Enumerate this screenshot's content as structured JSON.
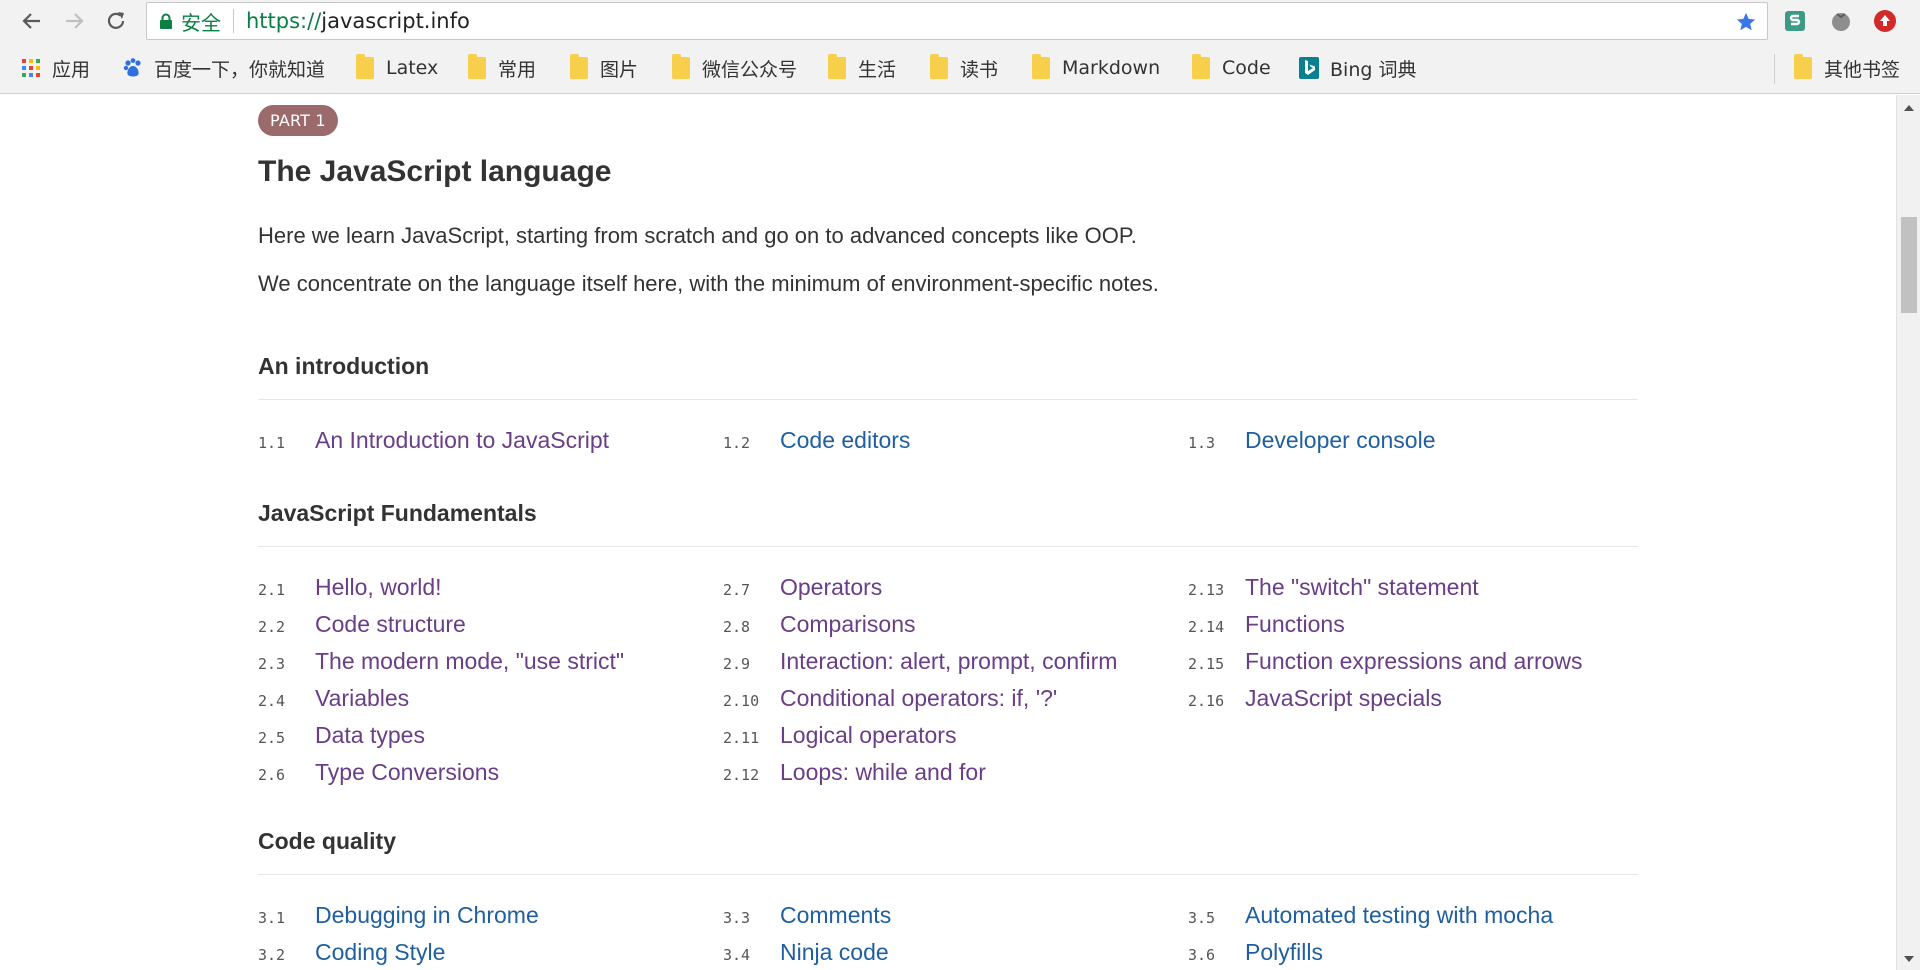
{
  "browser": {
    "secure_label": "安全",
    "url_scheme": "https://",
    "url_host": "javascript.info",
    "accent_star": "#3b78e7"
  },
  "bookmarks": [
    {
      "label": "应用",
      "icon": "apps-grid-icon"
    },
    {
      "label": "百度一下，你就知道",
      "icon": "baidu-paw-icon"
    },
    {
      "label": "Latex",
      "icon": "folder-icon"
    },
    {
      "label": "常用",
      "icon": "folder-icon"
    },
    {
      "label": "图片",
      "icon": "folder-icon"
    },
    {
      "label": "微信公众号",
      "icon": "folder-icon"
    },
    {
      "label": "生活",
      "icon": "folder-icon"
    },
    {
      "label": "读书",
      "icon": "folder-icon"
    },
    {
      "label": "Markdown",
      "icon": "folder-icon"
    },
    {
      "label": "Code",
      "icon": "folder-icon"
    },
    {
      "label": "Bing 词典",
      "icon": "bing-icon"
    },
    {
      "label": "其他书签",
      "icon": "folder-icon"
    }
  ],
  "page": {
    "part_badge": "PART 1",
    "title": "The JavaScript language",
    "intro": [
      "Here we learn JavaScript, starting from scratch and go on to advanced concepts like OOP.",
      "We concentrate on the language itself here, with the minimum of environment-specific notes."
    ],
    "sections": [
      {
        "title": "An introduction",
        "items": [
          {
            "num": "1.1",
            "label": "An Introduction to JavaScript",
            "visited": true
          },
          {
            "num": "1.2",
            "label": "Code editors",
            "visited": false
          },
          {
            "num": "1.3",
            "label": "Developer console",
            "visited": false
          }
        ]
      },
      {
        "title": "JavaScript Fundamentals",
        "items": [
          {
            "num": "2.1",
            "label": "Hello, world!",
            "visited": true
          },
          {
            "num": "2.2",
            "label": "Code structure",
            "visited": true
          },
          {
            "num": "2.3",
            "label": "The modern mode, \"use strict\"",
            "visited": true
          },
          {
            "num": "2.4",
            "label": "Variables",
            "visited": true
          },
          {
            "num": "2.5",
            "label": "Data types",
            "visited": true
          },
          {
            "num": "2.6",
            "label": "Type Conversions",
            "visited": true
          },
          {
            "num": "2.7",
            "label": "Operators",
            "visited": true
          },
          {
            "num": "2.8",
            "label": "Comparisons",
            "visited": true
          },
          {
            "num": "2.9",
            "label": "Interaction: alert, prompt, confirm",
            "visited": true
          },
          {
            "num": "2.10",
            "label": "Conditional operators: if, '?'",
            "visited": true
          },
          {
            "num": "2.11",
            "label": "Logical operators",
            "visited": true
          },
          {
            "num": "2.12",
            "label": "Loops: while and for",
            "visited": true
          },
          {
            "num": "2.13",
            "label": "The \"switch\" statement",
            "visited": true
          },
          {
            "num": "2.14",
            "label": "Functions",
            "visited": true
          },
          {
            "num": "2.15",
            "label": "Function expressions and arrows",
            "visited": true
          },
          {
            "num": "2.16",
            "label": "JavaScript specials",
            "visited": true
          }
        ]
      },
      {
        "title": "Code quality",
        "items": [
          {
            "num": "3.1",
            "label": "Debugging in Chrome",
            "visited": false
          },
          {
            "num": "3.2",
            "label": "Coding Style",
            "visited": false
          },
          {
            "num": "3.3",
            "label": "Comments",
            "visited": false
          },
          {
            "num": "3.4",
            "label": "Ninja code",
            "visited": false
          },
          {
            "num": "3.5",
            "label": "Automated testing with mocha",
            "visited": false
          },
          {
            "num": "3.6",
            "label": "Polyfills",
            "visited": false
          }
        ]
      }
    ]
  },
  "colors": {
    "visited_link": "#6a3d87",
    "new_link": "#1f5fa0",
    "badge_bg": "#9b6a6a"
  }
}
